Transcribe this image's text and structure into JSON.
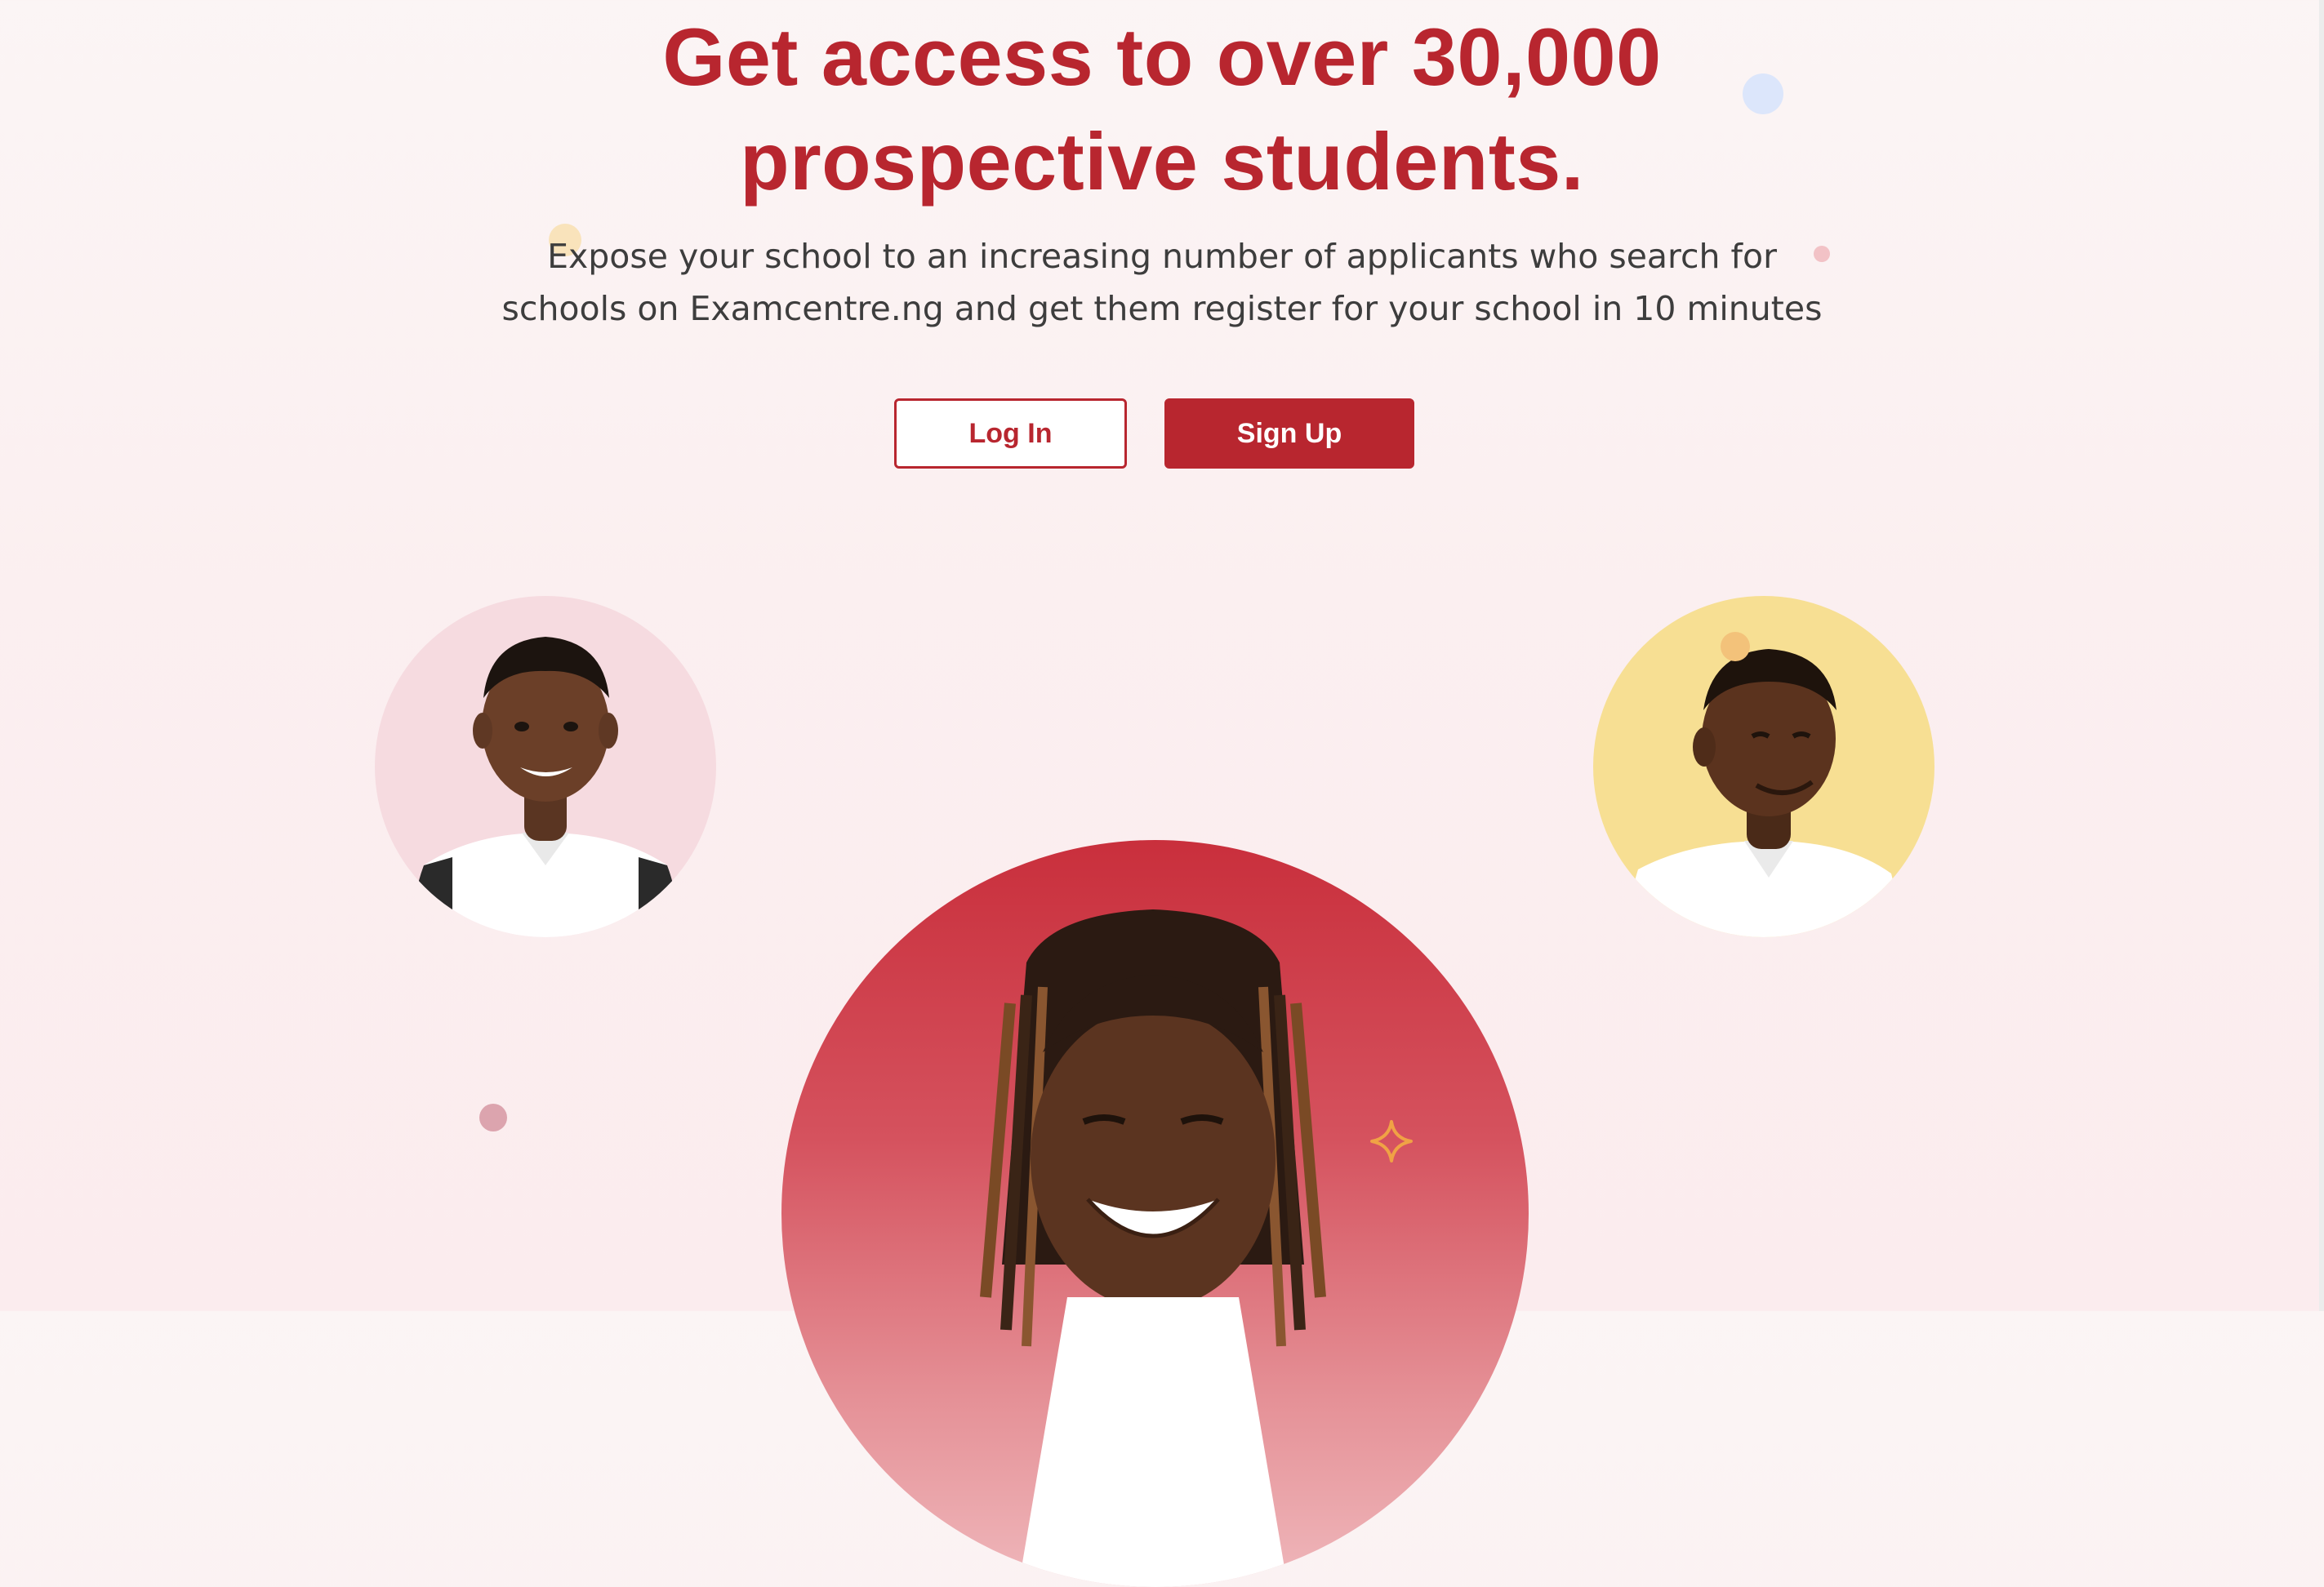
{
  "hero": {
    "title_line1": "Get access to over 30,000",
    "title_line2": "prospective students.",
    "subtitle_line1": "Expose your school to an increasing number of applicants who search for",
    "subtitle_line2": "schools on Examcentre.ng and get them register for your school in 10 minutes"
  },
  "actions": {
    "login_label": "Log In",
    "signup_label": "Sign Up"
  },
  "colors": {
    "brand": "#b8262f",
    "background": "#fbf0f1",
    "avatar_left_bg": "#f6dbe0",
    "avatar_right_bg": "#f7df93",
    "avatar_center_bg": "#c92f3c",
    "sparkle": "#f0a245"
  },
  "images": [
    "student-photo-left",
    "student-photo-right",
    "student-photo-center"
  ]
}
